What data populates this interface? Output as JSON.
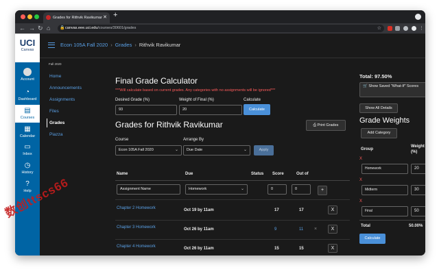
{
  "browser": {
    "tab_title": "Grades for Rithvik Ravikumar",
    "tab_close": "✕",
    "new_tab": "+",
    "url_domain": "canvas.eee.uci.edu",
    "url_path": "/courses/30601/grades",
    "colors": {
      "close": "#ff5f57",
      "minimize": "#febc2e",
      "maximize": "#28c840"
    }
  },
  "rail": {
    "logo_text": "UCI",
    "logo_sub": "Canvas",
    "items": [
      {
        "label": "Account",
        "icon": "account-icon"
      },
      {
        "label": "Dashboard",
        "icon": "dashboard-icon"
      },
      {
        "label": "Courses",
        "icon": "courses-icon"
      },
      {
        "label": "Calendar",
        "icon": "calendar-icon"
      },
      {
        "label": "Inbox",
        "icon": "inbox-icon"
      },
      {
        "label": "History",
        "icon": "history-icon"
      },
      {
        "label": "Help",
        "icon": "help-icon"
      }
    ]
  },
  "breadcrumb": {
    "course": "Econ 105A Fall 2020",
    "section": "Grades",
    "current": "Rithvik Ravikumar"
  },
  "course_nav": {
    "term": "Fall 2020",
    "items": [
      "Home",
      "Announcements",
      "Assignments",
      "Files",
      "Grades",
      "Piazza"
    ]
  },
  "calculator": {
    "title": "Final Grade Calculator",
    "warning": "***Will calculate based on current grades. Any categories with no assignments will be ignored***",
    "desired_label": "Desired Grade (%)",
    "desired_value": "93",
    "weight_label": "Weight of Final (%)",
    "weight_value": "20",
    "calc_label": "Calculate",
    "calc_button": "Calculate"
  },
  "grades": {
    "title": "Grades for Rithvik Ravikumar",
    "print_button": "Print Grades",
    "course_label": "Course",
    "course_value": "Econ 105A Fall 2020",
    "arrange_label": "Arrange By",
    "arrange_value": "Due Date",
    "apply_button": "Apply",
    "columns": {
      "name": "Name",
      "due": "Due",
      "status": "Status",
      "score": "Score",
      "out_of": "Out of"
    },
    "new_row": {
      "name": "Assignment Name",
      "category": "Homework",
      "score": "0",
      "out_of": "0",
      "add": "+"
    },
    "rows": [
      {
        "name": "Chapter 2 Homework",
        "due": "Oct 19 by 11am",
        "score": "17",
        "out_of": "17",
        "remove": "X",
        "note": ""
      },
      {
        "name": "Chapter 3 Homework",
        "due": "Oct 26 by 11am",
        "score": "9",
        "out_of": "11",
        "remove": "X",
        "note": "×"
      },
      {
        "name": "Chapter 4 Homework",
        "due": "Oct 26 by 11am",
        "score": "15",
        "out_of": "15",
        "remove": "X",
        "note": ""
      }
    ]
  },
  "sidebar": {
    "total": "Total: 97.50%",
    "show_saved": "Show Saved \"What-If\" Scores",
    "show_details": "Show All Details",
    "weights_title": "Grade Weights",
    "add_category": "Add Category",
    "group_header": "Group",
    "weight_header": "Weight (%)",
    "groups": [
      {
        "name": "Homework",
        "weight": "20"
      },
      {
        "name": "Midterm",
        "weight": "30"
      },
      {
        "name": "Final",
        "weight": "50"
      }
    ],
    "remove_mark": "X",
    "total_label": "Total",
    "total_value": "50.00%",
    "calc_button": "Calculate"
  },
  "watermark": "数创ttscs66"
}
